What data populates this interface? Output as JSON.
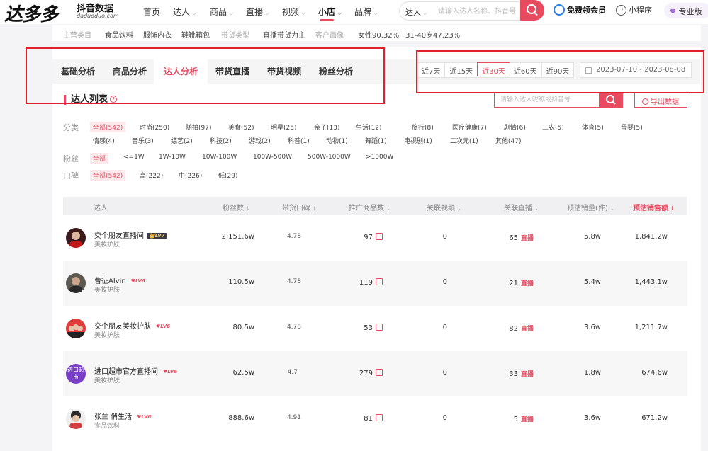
{
  "header": {
    "logo": "达多多",
    "logo_sub": "抖音数据",
    "logo_url": "daduoduo.com",
    "nav": [
      {
        "label": "首页",
        "has_caret": false
      },
      {
        "label": "达人",
        "has_caret": true
      },
      {
        "label": "商品",
        "has_caret": true
      },
      {
        "label": "直播",
        "has_caret": true
      },
      {
        "label": "视频",
        "has_caret": true
      },
      {
        "label": "小店",
        "has_caret": true,
        "active": true
      },
      {
        "label": "品牌",
        "has_caret": true
      }
    ],
    "search": {
      "scope": "达人",
      "placeholder": "请输入达人名称、抖音号"
    },
    "vip_label": "免费领会员",
    "mini_label": "小程序",
    "pro_label": "专业版"
  },
  "tag_strip": {
    "items": [
      {
        "text": "主营类目",
        "style": "gray"
      },
      {
        "text": "食品饮料",
        "style": "dark"
      },
      {
        "text": "服饰内衣",
        "style": "dark"
      },
      {
        "text": "鞋靴箱包",
        "style": "dark"
      },
      {
        "text": "带货类型",
        "style": "gray"
      },
      {
        "text": "直播带货为主",
        "style": "dark"
      },
      {
        "text": "客户画像",
        "style": "gray"
      },
      {
        "text": "女性90.32%",
        "style": "dark"
      },
      {
        "text": "31-40岁47.23%",
        "style": "dark"
      }
    ]
  },
  "tabs": [
    "基础分析",
    "商品分析",
    "达人分析",
    "带货直播",
    "带货视频",
    "粉丝分析"
  ],
  "active_tab": 2,
  "range": {
    "options": [
      "近7天",
      "近15天",
      "近30天",
      "近60天",
      "近90天"
    ],
    "active": 2,
    "date_range": "2023-07-10 - 2023-08-08"
  },
  "list": {
    "title": "达人列表",
    "search_placeholder": "请输入达人昵称或抖音号",
    "export_label": "导出数据"
  },
  "filters": {
    "category_label": "分类",
    "category_row1": [
      "全部(542)",
      "时尚(250)",
      "随拍(97)",
      "美食(52)",
      "明星(25)",
      "亲子(13)",
      "生活(12)",
      "旅行(8)",
      "医疗健康(7)",
      "剧情(6)",
      "三农(5)",
      "体育(5)",
      "母婴(5)"
    ],
    "category_row2": [
      "情感(4)",
      "音乐(3)",
      "综艺(2)",
      "科技(2)",
      "游戏(2)",
      "科普(1)",
      "动物(1)",
      "舞蹈(1)",
      "电视剧(1)",
      "二次元(1)",
      "其他(47)"
    ],
    "fans_label": "粉丝",
    "fans": [
      "全部",
      "<=1W",
      "1W-10W",
      "10W-100W",
      "100W-500W",
      "500W-1000W",
      ">1000W"
    ],
    "rep_label": "口碑",
    "rep": [
      "全部(542)",
      "高(222)",
      "中(226)",
      "低(29)"
    ]
  },
  "table": {
    "headers": [
      "达人",
      "粉丝数",
      "带货口碑",
      "推广商品数",
      "关联视频",
      "关联直播",
      "预估销量(件)",
      "预估销售额"
    ],
    "rows": [
      {
        "name": "交个朋友直播间",
        "level": "LV7",
        "category": "美妆护肤",
        "fans": "2,151.6w",
        "reputation": "4.78",
        "products": "97",
        "videos": "0",
        "lives": "65",
        "sales": "5.8w",
        "revenue": "1,841.2w"
      },
      {
        "name": "曹征Alvin",
        "level": "LV6",
        "category": "美妆护肤",
        "fans": "110.5w",
        "reputation": "4.78",
        "products": "119",
        "videos": "0",
        "lives": "21",
        "sales": "5.4w",
        "revenue": "1,443.1w"
      },
      {
        "name": "交个朋友美妆护肤",
        "level": "LV6",
        "category": "美妆护肤",
        "fans": "80.5w",
        "reputation": "4.78",
        "products": "53",
        "videos": "0",
        "lives": "82",
        "sales": "3.6w",
        "revenue": "1,211.7w"
      },
      {
        "name": "进口超市官方直播间",
        "level": "LV6",
        "category": "美妆护肤",
        "fans": "62.5w",
        "reputation": "4.7",
        "products": "279",
        "videos": "0",
        "lives": "33",
        "sales": "1.8w",
        "revenue": "674.6w"
      },
      {
        "name": "张兰 俏生活",
        "level": "LV6",
        "category": "食品饮料",
        "fans": "888.6w",
        "reputation": "4.91",
        "products": "81",
        "videos": "0",
        "lives": "5",
        "sales": "3.6w",
        "revenue": "671.2w"
      }
    ],
    "live_badge": "直播",
    "avatar_text_row4": "进口超市"
  },
  "colors": {
    "accent": "#e84a5f",
    "annotation": "#e0202a"
  }
}
